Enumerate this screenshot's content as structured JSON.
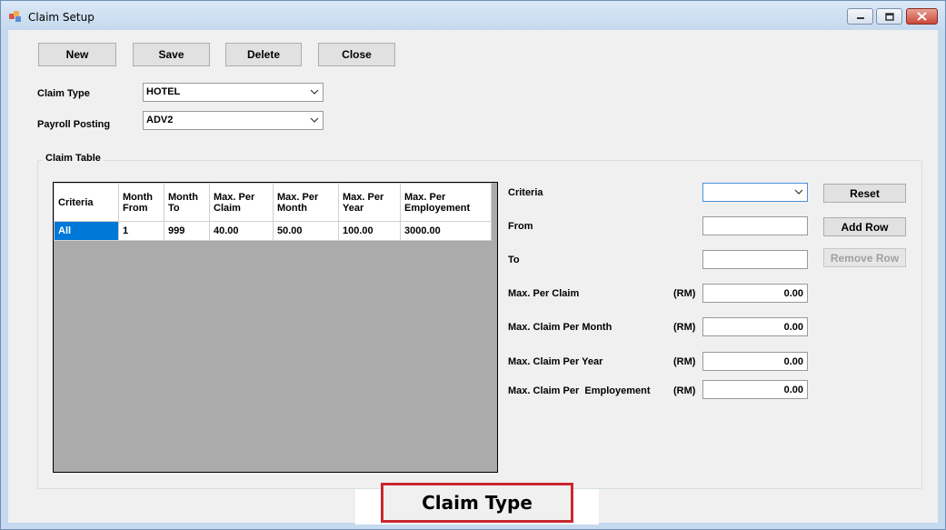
{
  "window": {
    "title": "Claim Setup"
  },
  "toolbar": {
    "new_label": "New",
    "save_label": "Save",
    "delete_label": "Delete",
    "close_label": "Close"
  },
  "form": {
    "claim_type_label": "Claim Type",
    "claim_type_value": "HOTEL",
    "payroll_posting_label": "Payroll Posting",
    "payroll_posting_value": "ADV2"
  },
  "claim_table": {
    "title": "Claim Table",
    "columns": [
      "Criteria",
      "Month From",
      "Month To",
      "Max. Per Claim",
      "Max. Per Month",
      "Max. Per Year",
      "Max. Per Employement"
    ],
    "rows": [
      [
        "All",
        "1",
        "999",
        "40.00",
        "50.00",
        "100.00",
        "3000.00"
      ]
    ]
  },
  "editor": {
    "criteria_label": "Criteria",
    "criteria_value": "",
    "from_label": "From",
    "from_value": "",
    "to_label": "To",
    "to_value": "",
    "max_per_claim_label": "Max. Per Claim",
    "max_per_claim_value": "0.00",
    "max_per_month_label": "Max. Claim Per Month",
    "max_per_month_value": "0.00",
    "max_per_year_label": "Max. Claim Per Year",
    "max_per_year_value": "0.00",
    "max_per_employment_label": "Max. Claim Per  Employement",
    "max_per_employment_value": "0.00",
    "currency_unit": "(RM)",
    "reset_label": "Reset",
    "add_row_label": "Add Row",
    "remove_row_label": "Remove Row"
  },
  "caption": {
    "text": "Claim Type",
    "border_color": "#c8282e"
  },
  "colors": {
    "selection": "#0078d7",
    "grid_background": "#ababab"
  }
}
